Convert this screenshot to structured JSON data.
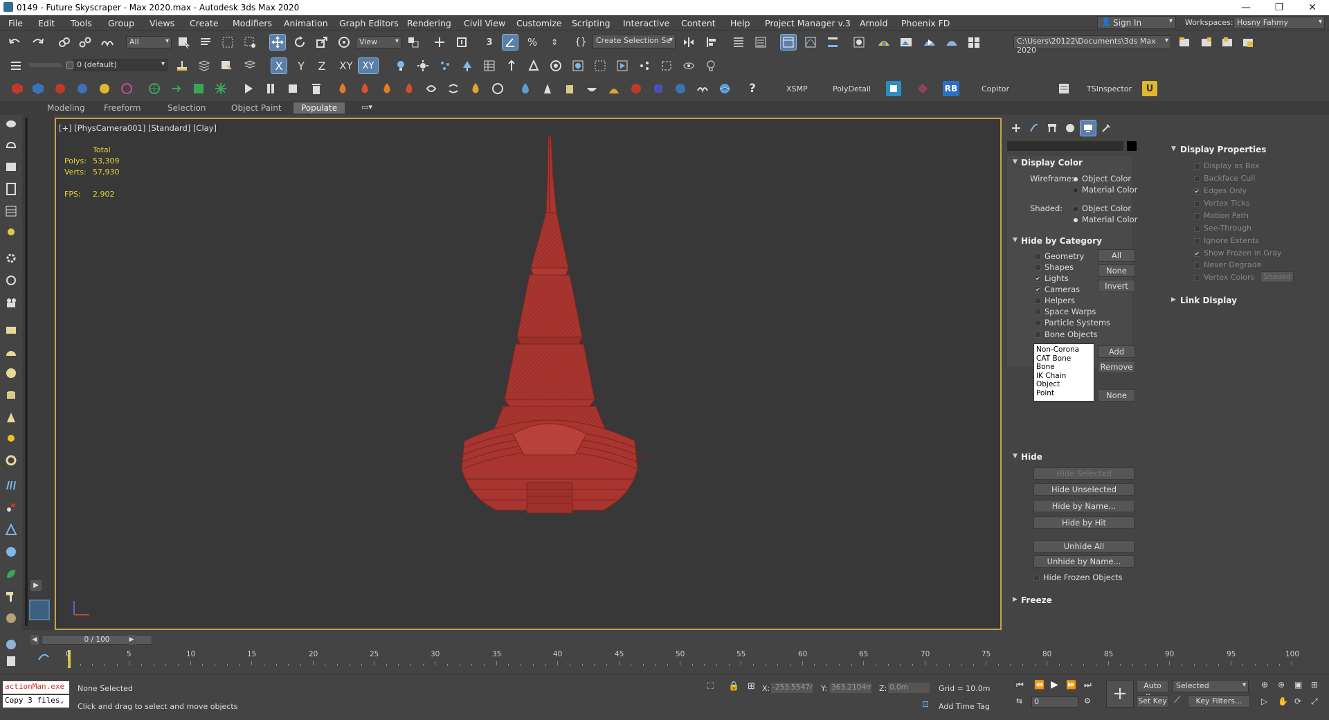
{
  "title": "0149 - Future Skyscraper - Max 2020.max - Autodesk 3ds Max 2020",
  "menu": [
    "File",
    "Edit",
    "Tools",
    "Group",
    "Views",
    "Create",
    "Modifiers",
    "Animation",
    "Graph Editors",
    "Rendering",
    "Civil View",
    "Customize",
    "Scripting",
    "Interactive",
    "Content",
    "Help",
    "Project Manager v.3",
    "Arnold",
    "Phoenix FD"
  ],
  "signin": "Sign In",
  "workspaces_label": "Workspaces:",
  "workspace": "Hosny Fahmy",
  "toolbar": {
    "selection_filter": "All",
    "ref_coord": "View",
    "create_selection_set": "Create Selection Se",
    "path": "C:\\Users\\20122\\Documents\\3ds Max 2020",
    "layer": "0 (default)",
    "axis_x": "X",
    "axis_y": "Y",
    "axis_z": "Z",
    "axis_xy": "XY",
    "axis_xy2": "XY",
    "plugins": [
      "XSMP",
      "PolyDetail",
      "RB",
      "Copitor",
      "TSInspector"
    ]
  },
  "ribbon_tabs": [
    "Modeling",
    "Freeform",
    "Selection",
    "Object Paint",
    "Populate"
  ],
  "viewport": {
    "label": "[+] [PhysCamera001] [Standard] [Clay]",
    "total": "Total",
    "polys_label": "Polys:",
    "polys": "53,309",
    "verts_label": "Verts:",
    "verts": "57,930",
    "fps_label": "FPS:",
    "fps": "2.902",
    "model_color": "#a8352f"
  },
  "display_panel": {
    "display_color": "Display Color",
    "wireframe": "Wireframe:",
    "shaded": "Shaded:",
    "object_color": "Object Color",
    "material_color": "Material Color",
    "hide_by_category": "Hide by Category",
    "categories": [
      {
        "label": "Geometry",
        "checked": false
      },
      {
        "label": "Shapes",
        "checked": false
      },
      {
        "label": "Lights",
        "checked": true
      },
      {
        "label": "Cameras",
        "checked": true
      },
      {
        "label": "Helpers",
        "checked": false
      },
      {
        "label": "Space Warps",
        "checked": false
      },
      {
        "label": "Particle Systems",
        "checked": false
      },
      {
        "label": "Bone Objects",
        "checked": false
      }
    ],
    "all": "All",
    "none": "None",
    "invert": "Invert",
    "list_items": [
      "Non-Corona",
      "CAT Bone",
      "Bone",
      "IK Chain Object",
      "Point"
    ],
    "add": "Add",
    "remove": "Remove",
    "none2": "None",
    "hide": "Hide",
    "hide_selected": "Hide Selected",
    "hide_unselected": "Hide Unselected",
    "hide_by_name": "Hide by Name...",
    "hide_by_hit": "Hide by Hit",
    "unhide_all": "Unhide All",
    "unhide_by_name": "Unhide by Name...",
    "hide_frozen": "Hide Frozen Objects",
    "freeze": "Freeze",
    "display_properties": "Display Properties",
    "props": [
      {
        "label": "Display as Box",
        "checked": false
      },
      {
        "label": "Backface Cull",
        "checked": false
      },
      {
        "label": "Edges Only",
        "checked": true
      },
      {
        "label": "Vertex Ticks",
        "checked": false
      },
      {
        "label": "Motion Path",
        "checked": false
      },
      {
        "label": "See-Through",
        "checked": false
      },
      {
        "label": "Ignore Extents",
        "checked": false
      },
      {
        "label": "Show Frozen in Gray",
        "checked": true
      },
      {
        "label": "Never Degrade",
        "checked": false
      },
      {
        "label": "Vertex Colors",
        "checked": false
      }
    ],
    "shaded_btn": "Shaded",
    "link_display": "Link Display"
  },
  "timeline": {
    "frame": "0 / 100",
    "ticks": [
      "0",
      "5",
      "10",
      "15",
      "20",
      "25",
      "30",
      "35",
      "40",
      "45",
      "50",
      "55",
      "60",
      "65",
      "70",
      "75",
      "80",
      "85",
      "90",
      "95",
      "100"
    ]
  },
  "status": {
    "script1": "actionMan.exe",
    "script2": "Copy 3 files,",
    "selection": "None Selected",
    "prompt": "Click and drag to select and move objects",
    "x_label": "X:",
    "x_val": "-253.5547r",
    "y_label": "Y:",
    "y_val": "363.2104m",
    "z_label": "Z:",
    "z_val": "0.0m",
    "grid": "Grid = 10.0m",
    "add_time_tag": "Add Time Tag",
    "auto_key": "Auto Key",
    "selected": "Selected",
    "set_key": "Set Key",
    "key_filters": "Key Filters...",
    "frame_field": "0"
  }
}
